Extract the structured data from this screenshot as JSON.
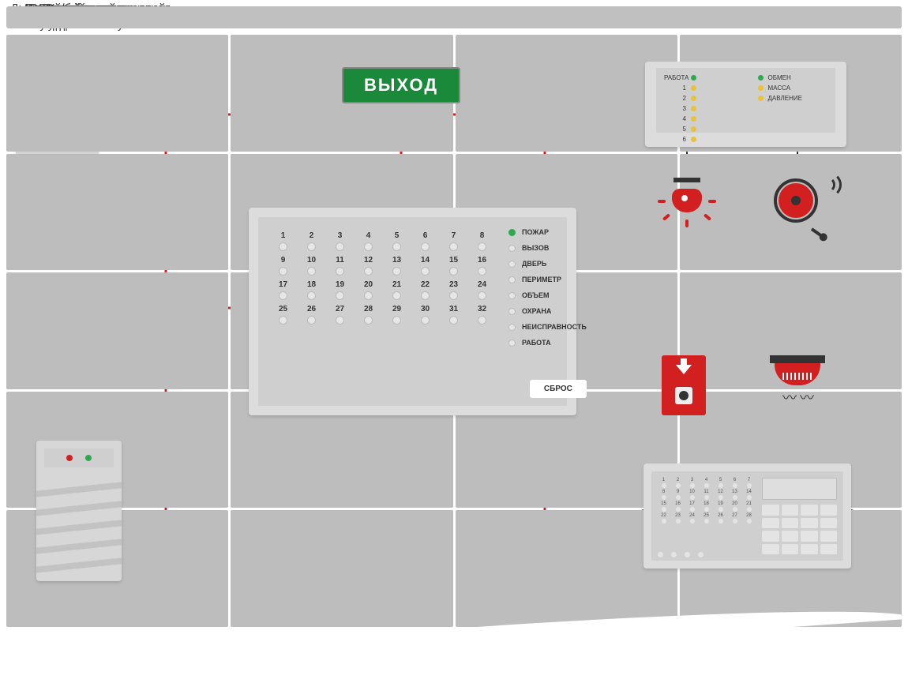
{
  "labels": {
    "control_keypad": "Пульт контроля\nи управления",
    "exit_notifier": "Оповещатель\nэвакуационных путей",
    "control_launch_block": "Контрольно-пусковой\nблок",
    "indication_block": "Блок индикации",
    "backup_power": "Блок резервного\nпитания",
    "light_notifier": "Световой\nоповещатель",
    "sound_notifier": "Звуковой\nоповещатель",
    "button_detector": "Кнопочный\nизвещатель",
    "smoke_heat_detector": "Дымовой/тепловой\nизвещатель",
    "control_panel": "Приборно-контрольная\nпанель"
  },
  "exit_sign_text": "ВЫХОД",
  "ctrl_block": {
    "left_header": "РАБОТА",
    "numbers": [
      "1",
      "2",
      "3",
      "4",
      "5",
      "6"
    ],
    "right": [
      {
        "label": "ОБМЕН",
        "color": "green"
      },
      {
        "label": "МАССА",
        "color": "yellow"
      },
      {
        "label": "ДАВЛЕНИЕ",
        "color": "yellow"
      }
    ]
  },
  "indication": {
    "zones_per_row": 8,
    "rows": 4,
    "statuses": [
      "ПОЖАР",
      "ВЫЗОВ",
      "ДВЕРЬ",
      "ПЕРИМЕТР",
      "ОБЪЕМ",
      "ОХРАНА",
      "НЕИСПРАВНОСТЬ",
      "РАБОТА"
    ],
    "active_status_index": 0,
    "reset_label": "СБРОС"
  },
  "panel_zones": {
    "count": 28,
    "cols": 7
  }
}
